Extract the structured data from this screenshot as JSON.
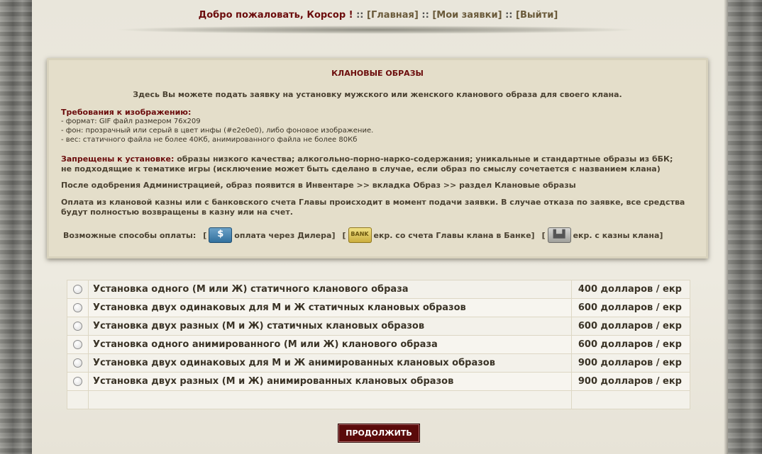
{
  "header": {
    "welcome": "Добро пожаловать, Корсор !",
    "sep": "::",
    "link_main": "[Главная]",
    "link_requests": "[Мои заявки]",
    "link_exit": "[Выйти]"
  },
  "panel": {
    "title": "КЛАНОВЫЕ ОБРАЗЫ",
    "intro": "Здесь Вы можете подать заявку на установку мужского или женского кланового образа для своего клана.",
    "requirements_head": "Требования к изображению:",
    "requirements": [
      "- формат: GIF файл размером 76х209",
      "- фон: прозрачный или серый в цвет инфы (#e2e0e0), либо фоновое изображение.",
      "- вес: статичного файла не более 40Кб, анимированного файла не более 80Кб"
    ],
    "forbidden_head": "Запрещены к установке:",
    "forbidden_text": "образы низкого качества; алкогольно-порно-нарко-содержания; уникальные и стандартные образы из бБК;",
    "forbidden_text2": "не подходящие к тематике игры (исключение может быть сделано в случае, если образ по смыслу сочетается с названием клана)",
    "after_approval": "После одобрения Администрацией, образ появится в Инвентаре >> вкладка Образ >> раздел Клановые образы",
    "payment_info": "Оплата из клановой казны или с банковского счета Главы происходит в момент подачи заявки. В случае отказа по заявке, все средства будут полностью возвращены в казну или на счет.",
    "methods_label": "Возможные способы оплаты:",
    "method_dealer": "оплата через Дилера",
    "method_bank": "екр. со счета Главы клана в Банке",
    "method_treasury": "екр. с казны клана",
    "icons": [
      "dealer-icon",
      "bank-icon",
      "castle-icon"
    ]
  },
  "options": [
    {
      "label": "Установка одного (М или Ж) статичного кланового образа",
      "price": "400 долларов / екр"
    },
    {
      "label": "Установка двух одинаковых для М и Ж статичных клановых образов",
      "price": "600 долларов / екр"
    },
    {
      "label": "Установка двух разных (М и Ж) статичных клановых образов",
      "price": "600 долларов / екр"
    },
    {
      "label": "Установка одного анимированного (М или Ж) кланового образа",
      "price": "600 долларов / екр"
    },
    {
      "label": "Установка двух одинаковых для М и Ж анимированных клановых образов",
      "price": "900 долларов / екр"
    },
    {
      "label": "Установка двух разных (М и Ж) анимированных клановых образов",
      "price": "900 долларов / екр"
    }
  ],
  "continue_label": "ПРОДОЛЖИТЬ",
  "colors": {
    "accent_dark_red": "#6b0c0c",
    "panel_bg": "#e4deca",
    "button_bg": "#5a0a0a"
  }
}
